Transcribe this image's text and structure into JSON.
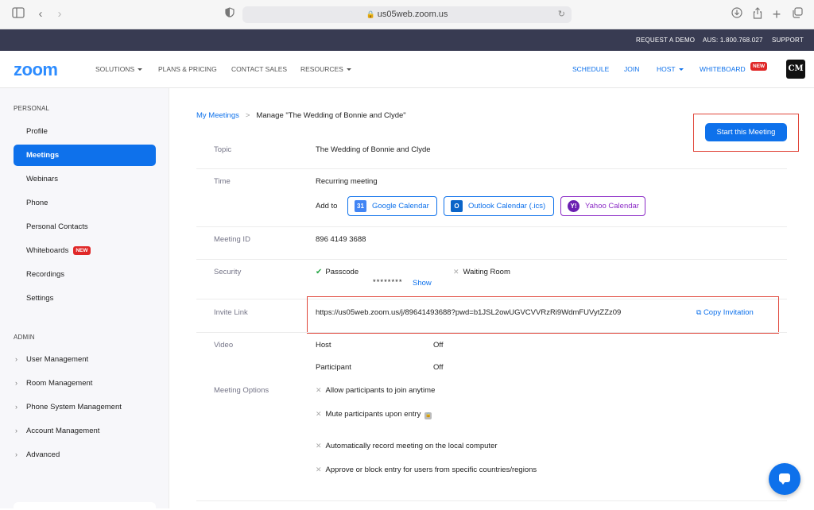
{
  "browser": {
    "url": "us05web.zoom.us",
    "icons": [
      "sidebar-icon",
      "back-icon",
      "forward-icon",
      "shield-icon",
      "download-icon",
      "share-icon",
      "new-tab-icon",
      "tabs-icon"
    ]
  },
  "topbar": {
    "request_demo": "REQUEST A DEMO",
    "phone": "AUS: 1.800.768.027",
    "support": "SUPPORT"
  },
  "nav": {
    "logo": "zoom",
    "solutions": "SOLUTIONS",
    "plans": "PLANS & PRICING",
    "contact": "CONTACT SALES",
    "resources": "RESOURCES",
    "schedule": "SCHEDULE",
    "join": "JOIN",
    "host": "HOST",
    "whiteboard": "WHITEBOARD",
    "new_badge": "NEW",
    "avatar": "CM"
  },
  "sidebar": {
    "personal_heading": "PERSONAL",
    "items": [
      {
        "label": "Profile"
      },
      {
        "label": "Meetings"
      },
      {
        "label": "Webinars"
      },
      {
        "label": "Phone"
      },
      {
        "label": "Personal Contacts"
      },
      {
        "label": "Whiteboards"
      },
      {
        "label": "Recordings"
      },
      {
        "label": "Settings"
      }
    ],
    "whiteboards_badge": "NEW",
    "admin_heading": "ADMIN",
    "admin_items": [
      {
        "label": "User Management"
      },
      {
        "label": "Room Management"
      },
      {
        "label": "Phone System Management"
      },
      {
        "label": "Account Management"
      },
      {
        "label": "Advanced"
      }
    ]
  },
  "main": {
    "breadcrumb_link": "My Meetings",
    "breadcrumb_sep": ">",
    "breadcrumb_current": "Manage \"The Wedding of Bonnie and Clyde\"",
    "start_button": "Start this Meeting",
    "topic_label": "Topic",
    "topic_value": "The Wedding of Bonnie and Clyde",
    "time_label": "Time",
    "time_value": "Recurring meeting",
    "add_to": "Add to",
    "google_cal": "Google Calendar",
    "outlook_cal": "Outlook Calendar (.ics)",
    "yahoo_cal": "Yahoo Calendar",
    "meeting_id_label": "Meeting ID",
    "meeting_id_value": "896 4149 3688",
    "security_label": "Security",
    "passcode": "Passcode",
    "passcode_mask": "********",
    "show": "Show",
    "waiting_room": "Waiting Room",
    "invite_label": "Invite Link",
    "invite_url": "https://us05web.zoom.us/j/89641493688?pwd=b1JSL2owUGVCVVRzRi9WdmFUVytZZz09",
    "copy_invitation": "Copy Invitation",
    "video_label": "Video",
    "host": "Host",
    "host_value": "Off",
    "participant": "Participant",
    "participant_value": "Off",
    "options_label": "Meeting Options",
    "options": [
      "Allow participants to join anytime",
      "Mute participants upon entry",
      "Automatically record meeting on the local computer",
      "Approve or block entry for users from specific countries/regions"
    ]
  },
  "colors": {
    "brand_blue": "#0e71eb",
    "zoom_logo": "#2d8cff",
    "topbar": "#383b52",
    "highlight_red": "#e0463a",
    "yahoo_purple": "#8b2ac6"
  }
}
